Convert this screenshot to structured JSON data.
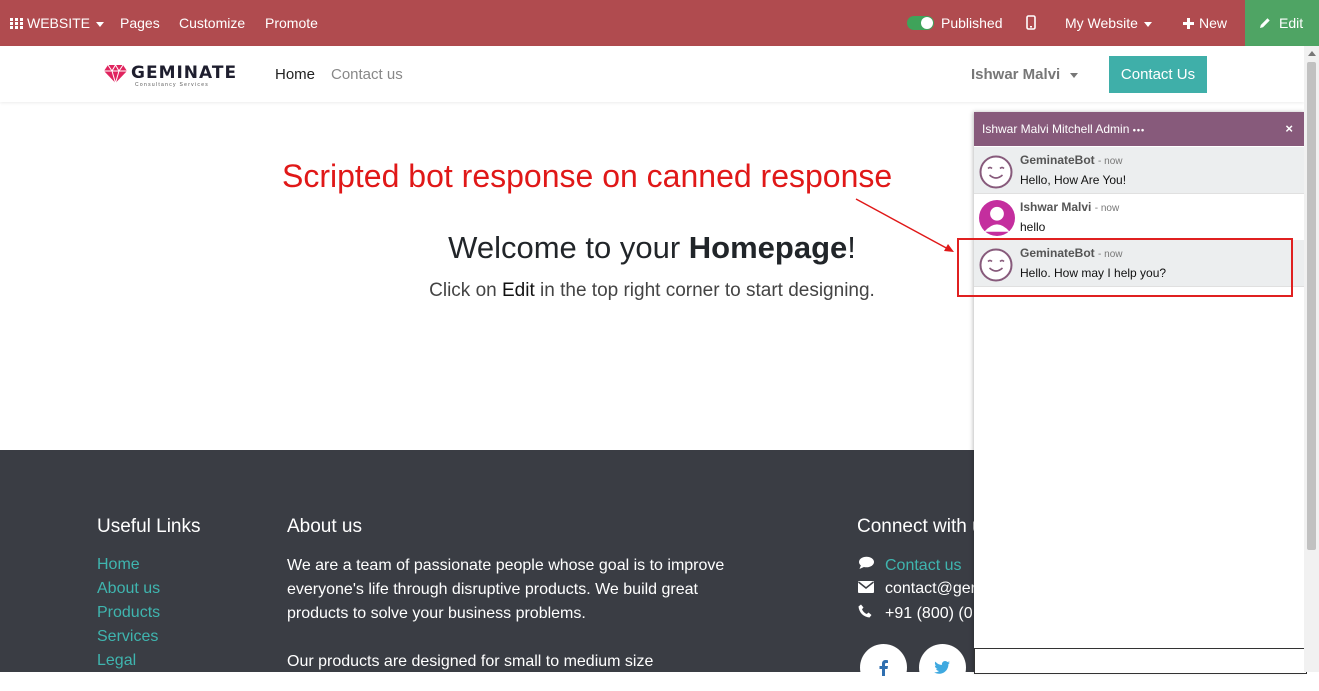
{
  "admin_bar": {
    "website_menu": "WEBSITE",
    "pages": "Pages",
    "customize": "Customize",
    "promote": "Promote",
    "published_label": "Published",
    "my_website": "My Website",
    "new_label": "New",
    "edit_label": "Edit",
    "bar_color": "#b04b4f",
    "edit_color": "#4fa464"
  },
  "header": {
    "logo_text": "GEMINATE",
    "logo_subtext": "Consultancy Services",
    "nav": [
      {
        "label": "Home",
        "active": true
      },
      {
        "label": "Contact us",
        "active": false
      }
    ],
    "user_name": "Ishwar Malvi",
    "cta_label": "Contact Us",
    "cta_color": "#3fafa9"
  },
  "annotation": {
    "text": "Scripted bot response on canned response",
    "color": "#e01818"
  },
  "main": {
    "welcome_prefix": "Welcome to your ",
    "welcome_bold": "Homepage",
    "welcome_suffix": "!",
    "sub_prefix": "Click on ",
    "sub_bold": "Edit",
    "sub_suffix": " in the top right corner to start designing."
  },
  "footer": {
    "useful_links_title": "Useful Links",
    "useful_links": [
      "Home",
      "About us",
      "Products",
      "Services",
      "Legal"
    ],
    "about_title": "About us",
    "about_text_1": "We are a team of passionate people whose goal is to improve everyone's life through disruptive products. We build great products to solve your business problems.",
    "about_text_2": "Our products are designed for small to medium size",
    "connect_title": "Connect with u",
    "contact_link": "Contact us",
    "email": "contact@ger",
    "phone": "+91 (800) (0"
  },
  "chat": {
    "title": "Ishwar Malvi Mitchell Admin",
    "title_dots": "•••",
    "close_icon": "×",
    "header_color": "#875a7b",
    "messages": [
      {
        "author": "GeminateBot",
        "time": "- now",
        "body": "Hello, How Are You!",
        "avatar": "bot-face-icon"
      },
      {
        "author": "Ishwar Malvi",
        "time": "- now",
        "body": "hello",
        "avatar": "user-avatar-icon"
      },
      {
        "author": "GeminateBot",
        "time": "- now",
        "body": "Hello. How may I help you?",
        "avatar": "bot-face-icon"
      }
    ],
    "input_value": ""
  }
}
